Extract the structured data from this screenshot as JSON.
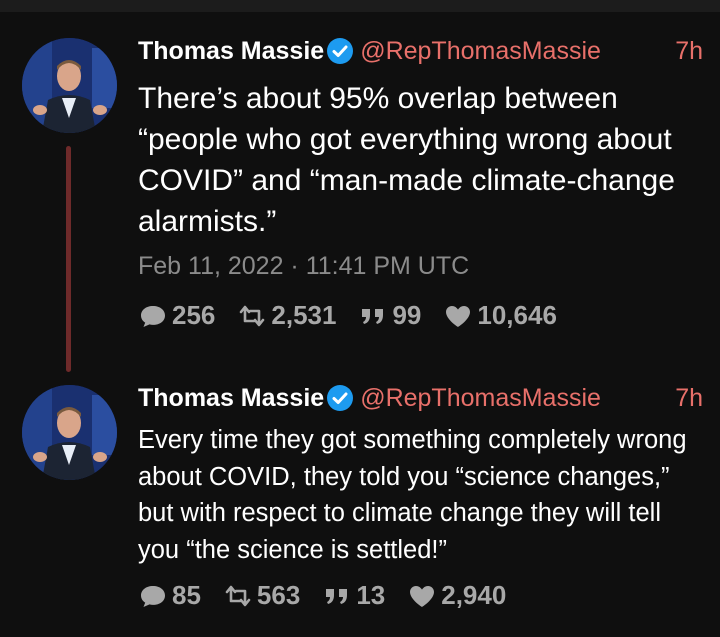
{
  "tweets": [
    {
      "author": "Thomas Massie",
      "handle": "@RepThomasMassie",
      "time": "7h",
      "text": "There’s about 95% overlap between “people who got everything wrong about COVID” and “man-made climate-change alarmists.”",
      "date": "Feb 11, 2022 · 11:41 PM UTC",
      "stats": {
        "replies": "256",
        "retweets": "2,531",
        "quotes": "99",
        "likes": "10,646"
      }
    },
    {
      "author": "Thomas Massie",
      "handle": "@RepThomasMassie",
      "time": "7h",
      "text": "Every time they got something completely wrong about COVID, they told you “science changes,” but with respect to climate change they will tell you “the science is settled!”",
      "stats": {
        "replies": "85",
        "retweets": "563",
        "quotes": "13",
        "likes": "2,940"
      }
    }
  ],
  "colors": {
    "background": "#0f0f0f",
    "handle": "#e8706a",
    "thread_line": "#6e2a2a",
    "verified": "#1d9bf0",
    "muted": "#a8a8a8"
  },
  "icons": {
    "reply": "comment-icon",
    "retweet": "retweet-icon",
    "quote": "quote-icon",
    "like": "heart-icon",
    "verified": "verified-badge-icon"
  }
}
